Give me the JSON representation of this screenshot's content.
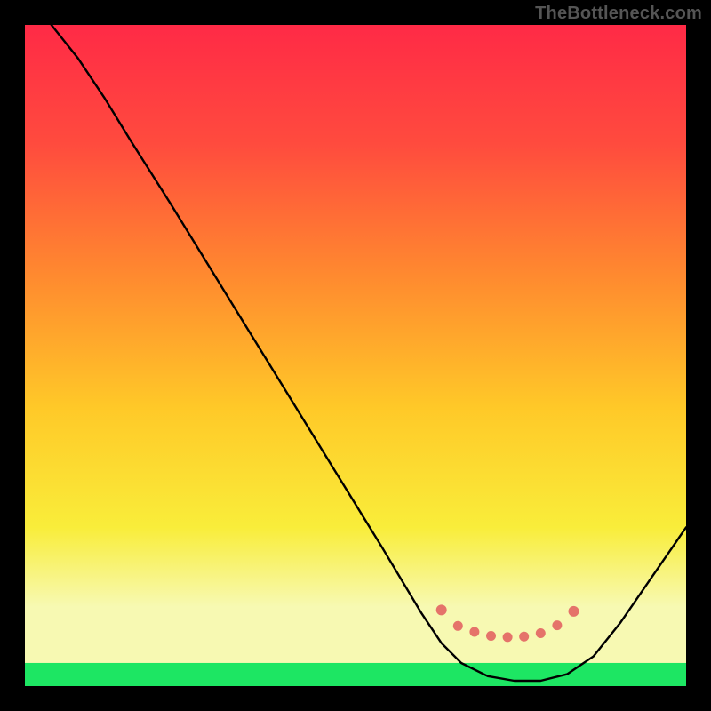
{
  "watermark": "TheBottleneck.com",
  "chart_data": {
    "type": "line",
    "title": "",
    "xlabel": "",
    "ylabel": "",
    "xlim": [
      0,
      100
    ],
    "ylim": [
      0,
      100
    ],
    "grid": false,
    "legend": false,
    "gradient_stops": [
      {
        "offset": 0,
        "color": "#ff2a46"
      },
      {
        "offset": 18,
        "color": "#ff4b3e"
      },
      {
        "offset": 38,
        "color": "#ff8a2f"
      },
      {
        "offset": 58,
        "color": "#ffc928"
      },
      {
        "offset": 76,
        "color": "#f9ed3a"
      },
      {
        "offset": 88,
        "color": "#f7f9b2"
      },
      {
        "offset": 95,
        "color": "#f7f9b2"
      },
      {
        "offset": 100,
        "color": "#1de663"
      }
    ],
    "green_band_y": [
      96.5,
      100
    ],
    "pale_band_y": [
      88,
      96.5
    ],
    "series": [
      {
        "name": "curve",
        "x": [
          4,
          8,
          12,
          16,
          22,
          30,
          38,
          46,
          54,
          60,
          63,
          66,
          70,
          74,
          78,
          82,
          86,
          90,
          100
        ],
        "y": [
          100,
          95,
          89,
          82.5,
          73,
          60,
          47,
          34,
          21,
          11,
          6.5,
          3.5,
          1.5,
          0.8,
          0.8,
          1.8,
          4.5,
          9.5,
          24
        ]
      }
    ],
    "highlight_points": {
      "name": "bottom-markers",
      "x": [
        63,
        65.5,
        68,
        70.5,
        73,
        75.5,
        78,
        80.5,
        83
      ],
      "y_percent_from_top": [
        88.5,
        90.9,
        91.8,
        92.4,
        92.6,
        92.5,
        92.0,
        90.8,
        88.7
      ]
    }
  }
}
